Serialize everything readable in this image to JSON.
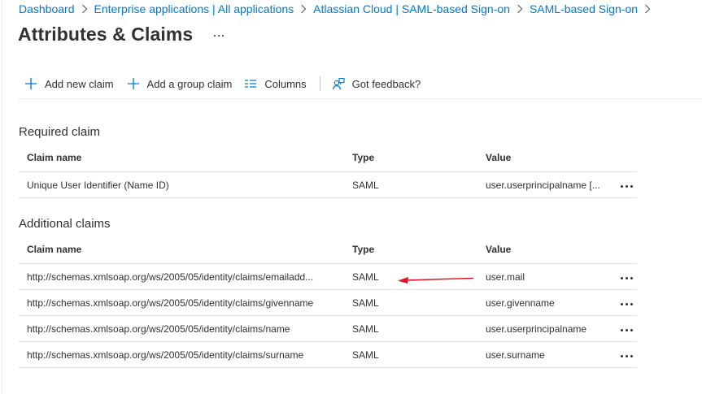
{
  "breadcrumb": [
    {
      "label": "Dashboard"
    },
    {
      "label": "Enterprise applications | All applications"
    },
    {
      "label": "Atlassian Cloud | SAML-based Sign-on"
    },
    {
      "label": "SAML-based Sign-on"
    }
  ],
  "page": {
    "title": "Attributes & Claims",
    "more_label": "···"
  },
  "toolbar": {
    "add_claim": "Add new claim",
    "add_group_claim": "Add a group claim",
    "columns": "Columns",
    "feedback": "Got feedback?"
  },
  "required_section": {
    "title": "Required claim",
    "columns": {
      "name": "Claim name",
      "type": "Type",
      "value": "Value"
    },
    "rows": [
      {
        "name": "Unique User Identifier (Name ID)",
        "type": "SAML",
        "value": "user.userprincipalname [..."
      }
    ]
  },
  "additional_section": {
    "title": "Additional claims",
    "columns": {
      "name": "Claim name",
      "type": "Type",
      "value": "Value"
    },
    "rows": [
      {
        "name": "http://schemas.xmlsoap.org/ws/2005/05/identity/claims/emailadd...",
        "type": "SAML",
        "value": "user.mail"
      },
      {
        "name": "http://schemas.xmlsoap.org/ws/2005/05/identity/claims/givenname",
        "type": "SAML",
        "value": "user.givenname"
      },
      {
        "name": "http://schemas.xmlsoap.org/ws/2005/05/identity/claims/name",
        "type": "SAML",
        "value": "user.userprincipalname"
      },
      {
        "name": "http://schemas.xmlsoap.org/ws/2005/05/identity/claims/surname",
        "type": "SAML",
        "value": "user.surname"
      }
    ]
  },
  "icons": {
    "chevron": "chevron-right-icon",
    "add": "plus-icon",
    "columns": "columns-icon",
    "feedback": "feedback-icon",
    "more": "more-icon",
    "annotation": "red-arrow-icon"
  },
  "colors": {
    "link": "#0078d4",
    "accent": "#0078d4",
    "annotation": "#e81123",
    "text": "#323130"
  }
}
